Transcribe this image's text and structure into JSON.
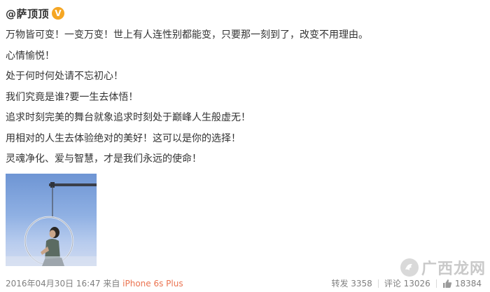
{
  "post": {
    "username": "@萨顶顶",
    "verified_badge": "V",
    "lines": [
      "万物皆可变！一变万变！世上有人连性别都能变，只要那一刻到了，改变不用理由。",
      "心情愉悦！",
      "处于何时何处请不忘初心！",
      "我们究竟是谁?要一生去体悟！",
      "追求时刻完美的舞台就象追求时刻处于巅峰人生般虚无！",
      "用相对的人生去体验绝对的美好！这可以是你的选择！",
      "灵魂净化、爱与智慧，才是我们永远的使命！"
    ]
  },
  "footer": {
    "timestamp": "2016年04月30日 16:47",
    "source_prefix": "来自",
    "device": "iPhone 6s Plus",
    "repost": "转发 3358",
    "comment": "评论 13026",
    "likes": "18384"
  },
  "watermark": {
    "text": "广西龙网"
  },
  "colors": {
    "device_link": "#eb7350",
    "badge": "#f5a623",
    "meta_gray": "#808080",
    "text": "#333333"
  }
}
